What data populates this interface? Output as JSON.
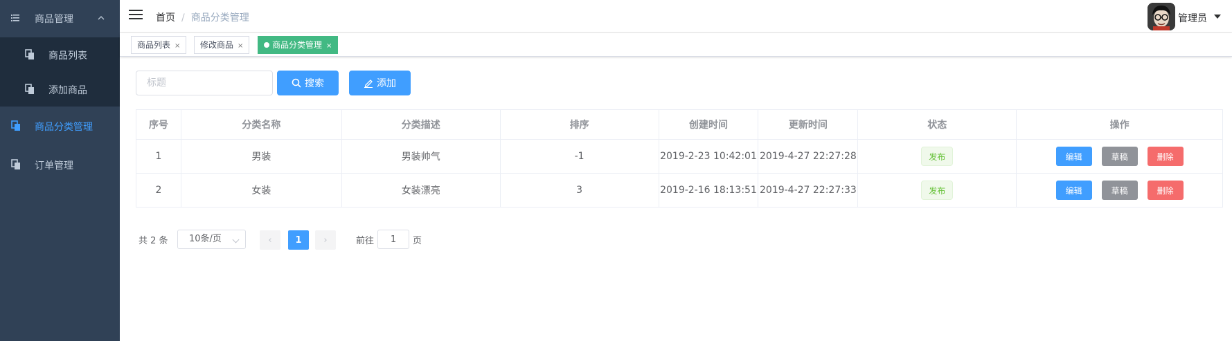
{
  "sidebar": {
    "group_title": "商品管理",
    "sub_items": [
      {
        "label": "商品列表"
      },
      {
        "label": "添加商品"
      }
    ],
    "items": [
      {
        "label": "商品分类管理",
        "active": true
      },
      {
        "label": "订单管理",
        "active": false
      }
    ]
  },
  "navbar": {
    "breadcrumb_home": "首页",
    "breadcrumb_separator": "/",
    "breadcrumb_current": "商品分类管理",
    "user_name": "管理员"
  },
  "tags": [
    {
      "label": "商品列表",
      "close": "×",
      "active": false
    },
    {
      "label": "修改商品",
      "close": "×",
      "active": false
    },
    {
      "label": "商品分类管理",
      "close": "×",
      "active": true
    }
  ],
  "filter": {
    "placeholder": "标题",
    "search_label": "搜索",
    "add_label": "添加"
  },
  "table": {
    "headers": [
      "序号",
      "分类名称",
      "分类描述",
      "排序",
      "创建时间",
      "更新时间",
      "状态",
      "操作"
    ],
    "rows": [
      {
        "index": "1",
        "name": "男装",
        "desc": "男装帅气",
        "sort": "-1",
        "created": "2019-2-23 10:42:01",
        "updated": "2019-4-27 22:27:28",
        "status": "发布"
      },
      {
        "index": "2",
        "name": "女装",
        "desc": "女装漂亮",
        "sort": "3",
        "created": "2019-2-16 18:13:51",
        "updated": "2019-4-27 22:27:33",
        "status": "发布"
      }
    ],
    "actions": {
      "edit": "编辑",
      "draft": "草稿",
      "delete": "删除"
    }
  },
  "pagination": {
    "total": "共 2 条",
    "page_size": "10条/页",
    "prev": "‹",
    "current_page": "1",
    "next": "›",
    "goto_label": "前往",
    "goto_value": "1",
    "page_label": "页"
  },
  "colors": {
    "sidebar_bg": "#304156",
    "submenu_bg": "#1f2d3d",
    "primary": "#409eff",
    "tag_active": "#42b983",
    "success": "#67c23a",
    "info": "#909399",
    "danger": "#f56c6c"
  }
}
